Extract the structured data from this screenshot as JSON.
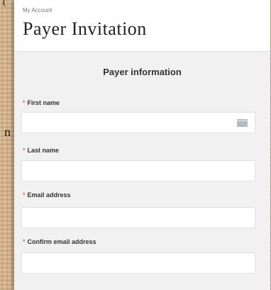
{
  "backdrop": {
    "side_text": "n",
    "corner_text": "("
  },
  "header": {
    "breadcrumb": "My Account",
    "title": "Payer Invitation"
  },
  "form": {
    "section_title": "Payer information",
    "required_marker": "*",
    "fields": [
      {
        "label": "First name",
        "value": "",
        "icon": "calendar-icon"
      },
      {
        "label": "Last name",
        "value": ""
      },
      {
        "label": "Email address",
        "value": ""
      },
      {
        "label": "Confirm email address",
        "value": ""
      }
    ]
  }
}
